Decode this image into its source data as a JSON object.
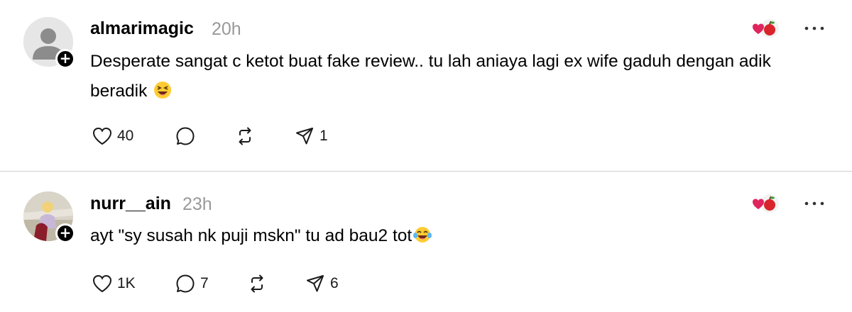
{
  "posts": [
    {
      "username": "almarimagic",
      "timestamp": "20h",
      "avatar": "default-person-avatar",
      "text": "Desperate sangat c ketot buat fake review.. tu lah aniaya lagi ex wife gaduh dengan adik beradik",
      "emoji": "squinting-laughing-face",
      "reaction_badge": "heart-apple",
      "actions": {
        "like_count": "40",
        "reply_count": "",
        "repost_count": "",
        "share_count": "1"
      }
    },
    {
      "username": "nurr__ain",
      "timestamp": "23h",
      "avatar": "photo-avatar",
      "text": "ayt \"sy susah nk puji mskn\" tu ad bau2 tot",
      "emoji": "tears-of-joy-face",
      "reaction_badge": "heart-apple",
      "actions": {
        "like_count": "1K",
        "reply_count": "7",
        "repost_count": "",
        "share_count": "6"
      }
    }
  ],
  "icons": {
    "like": "heart-outline-icon",
    "reply": "speech-bubble-icon",
    "repost": "repost-arrows-icon",
    "share": "paper-plane-icon",
    "more": "more-horizontal-icon",
    "follow": "plus-icon"
  },
  "colors": {
    "text": "#000000",
    "timestamp": "#999999",
    "divider": "#cfcfcf",
    "heart_red": "#e0245e",
    "apple_red": "#d8242a"
  }
}
